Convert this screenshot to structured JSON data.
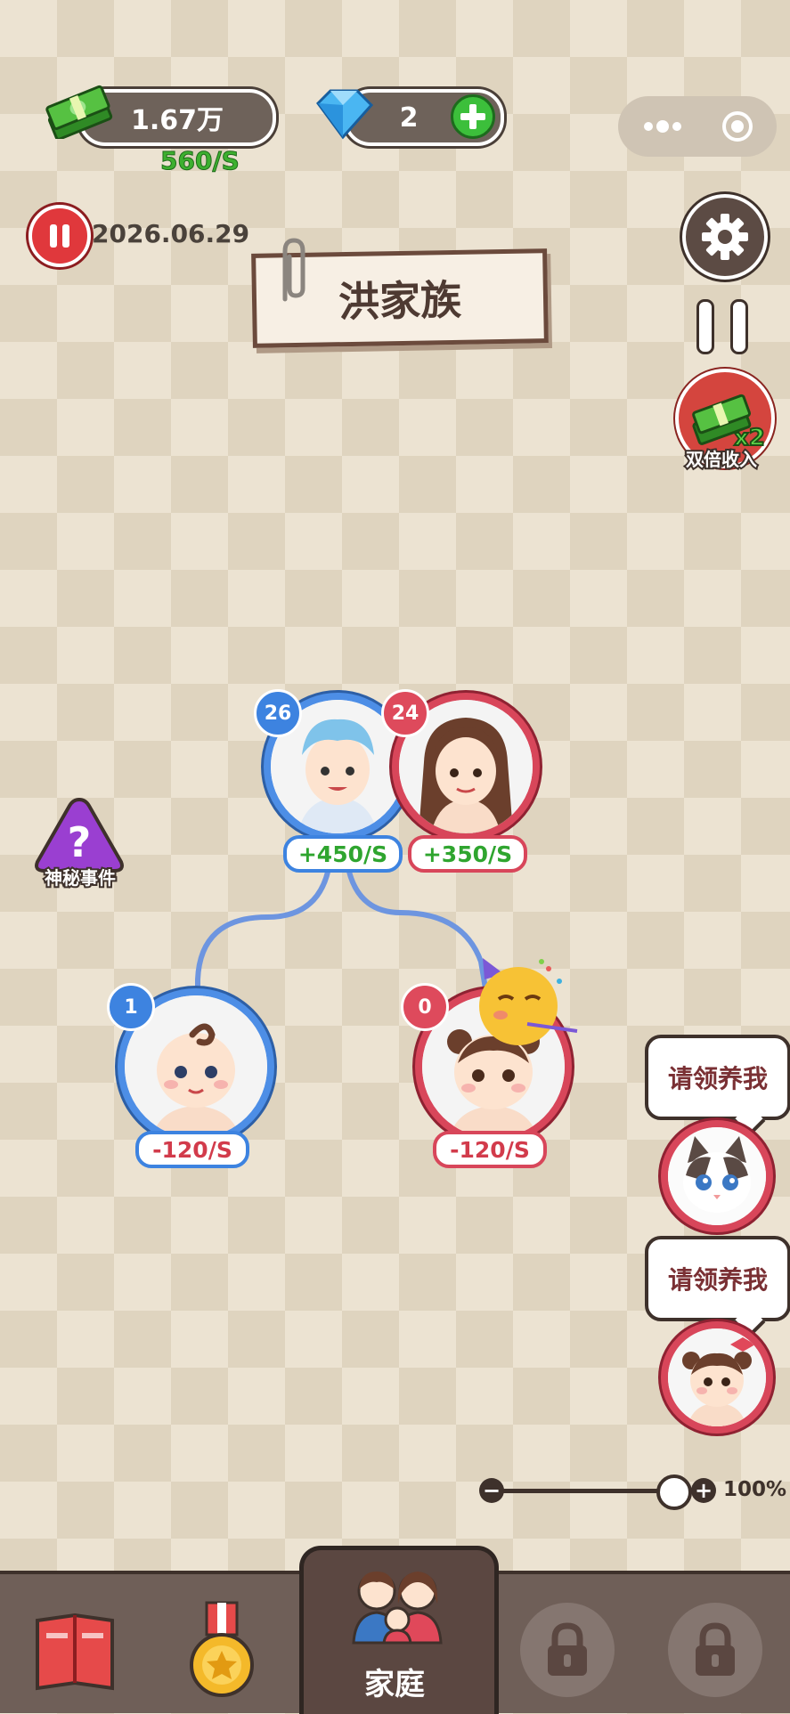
{
  "header": {
    "cash_amount": "1.67万",
    "income_rate": "560/S",
    "gems": "2",
    "date": "2026.06.29",
    "family_name": "洪家族"
  },
  "side_buttons": {
    "double_income_label": "双倍收入",
    "mystery_event_label": "神秘事件"
  },
  "family": {
    "father": {
      "age": "26",
      "rate": "+450/S"
    },
    "mother": {
      "age": "24",
      "rate": "+350/S"
    },
    "son": {
      "age": "1",
      "rate": "-120/S"
    },
    "daughter": {
      "age": "0",
      "rate": "-120/S"
    }
  },
  "adopt": [
    {
      "bubble": "请领养我",
      "kind": "cat"
    },
    {
      "bubble": "请领养我",
      "kind": "baby-girl"
    }
  ],
  "zoom": {
    "level": "100%",
    "fraction": 1.0
  },
  "bottom_nav": {
    "active_tab": "家庭",
    "tabs": [
      "book-icon",
      "medal-icon",
      "family-icon",
      "lock-icon",
      "lock-icon"
    ]
  },
  "colors": {
    "male_accent": "#4d8ee6",
    "female_accent": "#d8465a",
    "income_green": "#3db02f",
    "panel_brown": "#6f5f58"
  }
}
